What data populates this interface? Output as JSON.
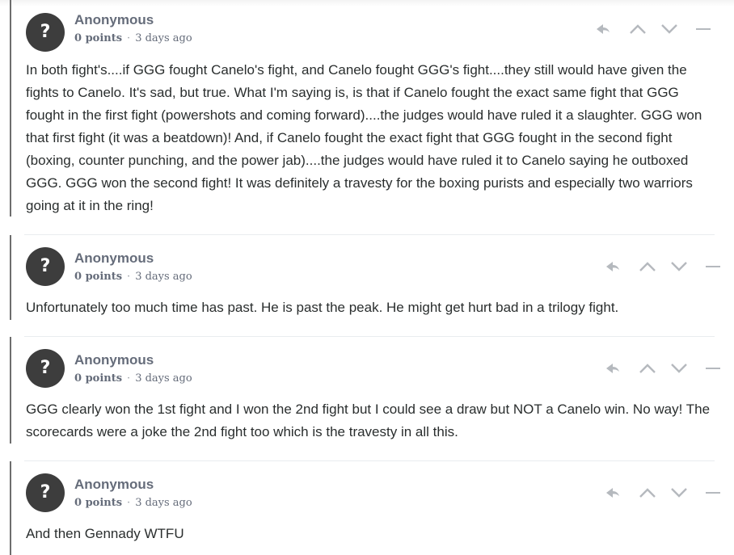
{
  "comments": [
    {
      "avatar_glyph": "?",
      "author": "Anonymous",
      "points": "0 points",
      "separator": "·",
      "time": "3 days ago",
      "text": "In both fight's....if GGG fought Canelo's fight, and Canelo fought GGG's fight....they still would have given the fights to Canelo. It's sad, but true. What I'm saying is, is that if Canelo fought the exact same fight that GGG fought in the first fight (powershots and coming forward)....the judges would have ruled it a slaughter. GGG won that first fight (it was a beatdown)! And, if Canelo fought the exact fight that GGG fought in the second fight (boxing, counter punching, and the power jab)....the judges would have ruled it to Canelo saying he outboxed GGG. GGG won the second fight! It was definitely a travesty for the boxing purists and especially two warriors going at it in the ring!"
    },
    {
      "avatar_glyph": "?",
      "author": "Anonymous",
      "points": "0 points",
      "separator": "·",
      "time": "3 days ago",
      "text": "Unfortunately too much time has past. He is past the peak. He might get hurt bad in a trilogy fight."
    },
    {
      "avatar_glyph": "?",
      "author": "Anonymous",
      "points": "0 points",
      "separator": "·",
      "time": "3 days ago",
      "text": "GGG clearly won the 1st fight and I won the 2nd fight but I could see a draw but NOT a Canelo win. No way! The scorecards were a joke the 2nd fight too which is the travesty in all this."
    },
    {
      "avatar_glyph": "?",
      "author": "Anonymous",
      "points": "0 points",
      "separator": "·",
      "time": "3 days ago",
      "text": "And then Gennady WTFU"
    }
  ],
  "icons": {
    "reply": "reply-icon",
    "upvote": "upvote-icon",
    "downvote": "downvote-icon",
    "collapse": "collapse-icon"
  },
  "colors": {
    "avatar_bg": "#3d3d3d",
    "meta_text": "#656c7a",
    "icon": "#b5b9be",
    "thread_line": "#6d6d6d"
  }
}
